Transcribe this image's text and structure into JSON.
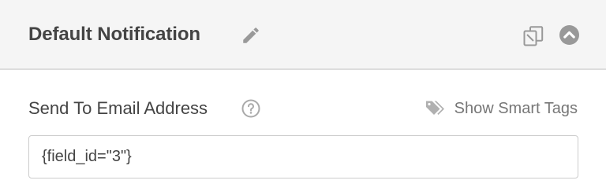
{
  "header": {
    "title": "Default Notification",
    "icons": {
      "edit": "pencil-icon",
      "clone": "clone-icon",
      "collapse": "chevron-up-circle-icon"
    }
  },
  "field": {
    "label": "Send To Email Address",
    "help_icon": "question-circle-icon",
    "smart_tags_label": "Show Smart Tags",
    "smart_tags_icon": "tags-icon",
    "value": "{field_id=\"3\"}"
  },
  "colors": {
    "header_bg": "#f5f5f5",
    "header_border": "#dddddd",
    "title_text": "#444444",
    "icon_gray": "#999999",
    "muted_text": "#777777",
    "input_border": "#cccccc"
  }
}
